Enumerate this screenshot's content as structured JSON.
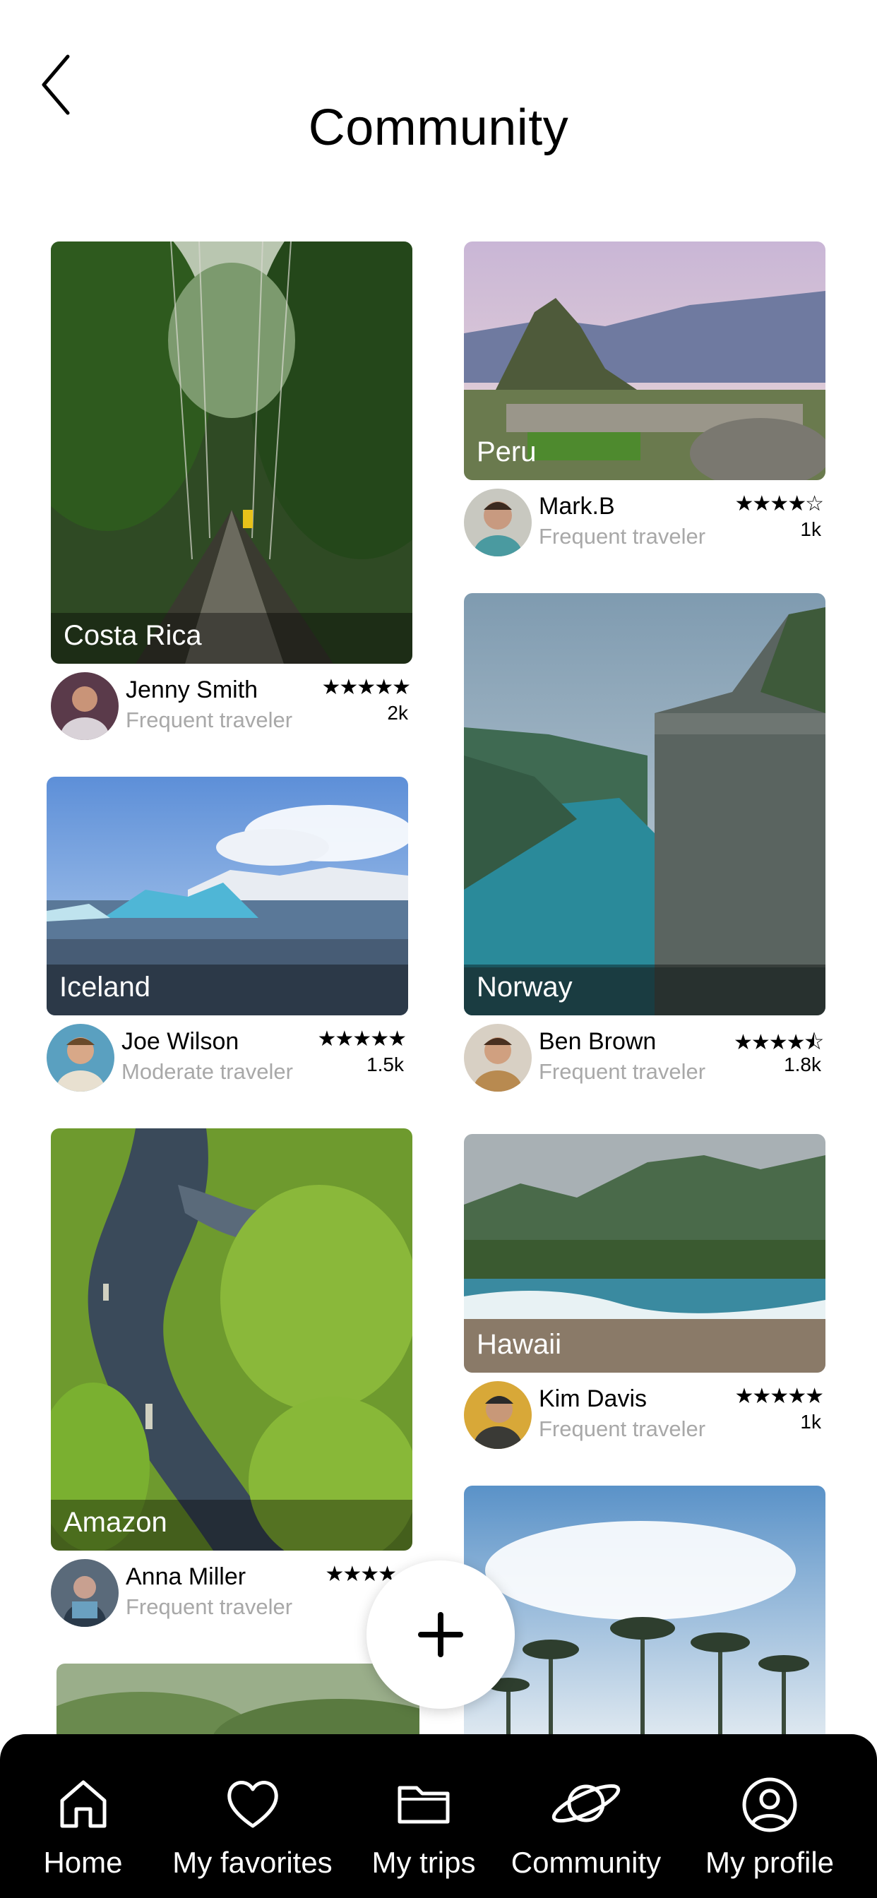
{
  "header": {
    "title": "Community",
    "back_icon": "chevron-left-icon"
  },
  "cards": [
    {
      "place": "Costa Rica",
      "author": "Jenny Smith",
      "level": "Frequent traveler",
      "stars": "★★★★★",
      "rating": 5,
      "count": "2k"
    },
    {
      "place": "Peru",
      "author": "Mark.B",
      "level": "Frequent traveler",
      "stars": "★★★★☆",
      "rating": 4,
      "count": "1k"
    },
    {
      "place": "Iceland",
      "author": "Joe Wilson",
      "level": "Moderate traveler",
      "stars": "★★★★★",
      "rating": 5,
      "count": "1.5k"
    },
    {
      "place": "Norway",
      "author": "Ben Brown",
      "level": "Frequent traveler",
      "stars": "★★★★⯪",
      "rating": 4.5,
      "count": "1.8k"
    },
    {
      "place": "Amazon",
      "author": "Anna Miller",
      "level": "Frequent traveler",
      "stars": "★★★★",
      "rating": 4,
      "count": ""
    },
    {
      "place": "Hawaii",
      "author": "Kim Davis",
      "level": "Frequent traveler",
      "stars": "★★★★★",
      "rating": 5,
      "count": "1k"
    }
  ],
  "fab": {
    "icon": "plus-icon"
  },
  "tabbar": {
    "items": [
      {
        "label": "Home",
        "icon": "home-icon"
      },
      {
        "label": "My favorites",
        "icon": "heart-icon"
      },
      {
        "label": "My trips",
        "icon": "folder-icon"
      },
      {
        "label": "Community",
        "icon": "planet-icon"
      },
      {
        "label": "My profile",
        "icon": "user-circle-icon"
      }
    ]
  },
  "colors": {
    "background": "#ffffff",
    "tabbar": "#000000",
    "muted_text": "#a8a8a8",
    "label_overlay": "rgba(0,0,0,0.38)"
  }
}
